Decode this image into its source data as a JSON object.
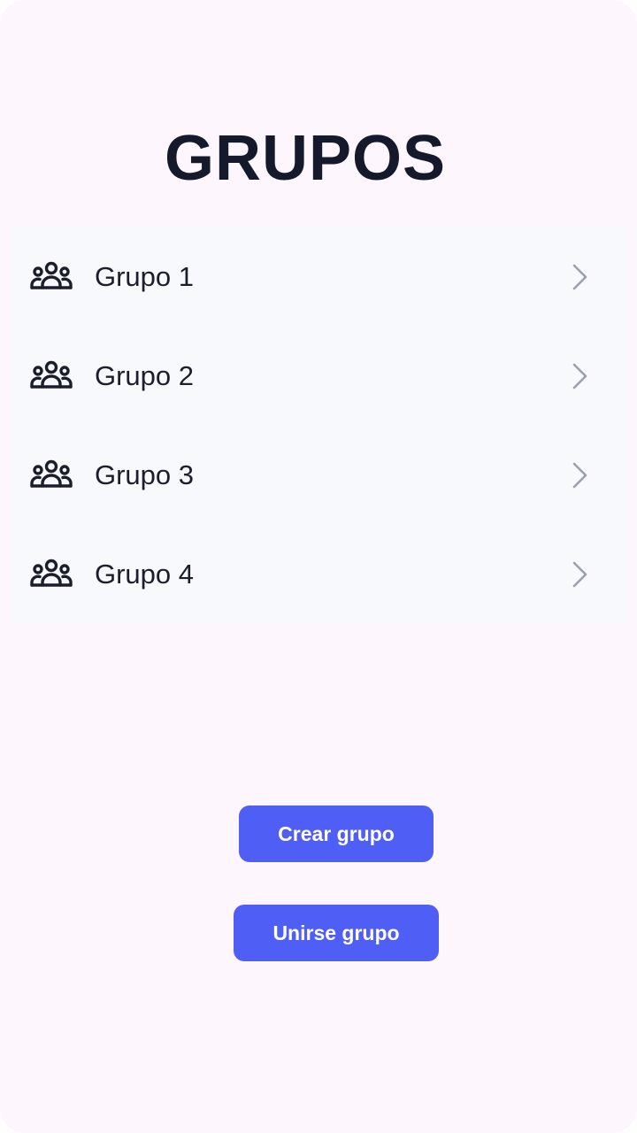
{
  "page": {
    "title": "GRUPOS"
  },
  "groups": [
    {
      "label": "Grupo 1",
      "icon": "group-icon"
    },
    {
      "label": "Grupo 2",
      "icon": "group-icon"
    },
    {
      "label": "Grupo 3",
      "icon": "group-icon"
    },
    {
      "label": "Grupo 4",
      "icon": "group-icon"
    }
  ],
  "actions": {
    "create_label": "Crear grupo",
    "join_label": "Unirse grupo"
  },
  "colors": {
    "background": "#fdf7fd",
    "list_background": "#f8f9fc",
    "primary": "#4f5ef5",
    "text": "#141a2b",
    "chevron": "#9aa0ae"
  }
}
